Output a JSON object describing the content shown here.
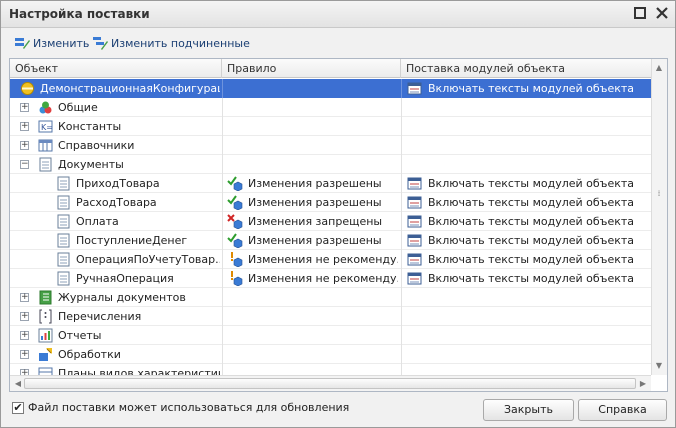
{
  "window": {
    "title": "Настройка поставки"
  },
  "toolbar": {
    "edit": "Изменить",
    "edit_children": "Изменить подчиненные"
  },
  "columns": {
    "object": "Объект",
    "rule": "Правило",
    "delivery": "Поставка модулей объекта"
  },
  "rows": [
    {
      "label": "ДемонстрационнаяКонфигурац...",
      "rule": "",
      "delivery": "Включать тексты модулей объекта"
    },
    {
      "label": "Общие",
      "rule": "",
      "delivery": ""
    },
    {
      "label": "Константы",
      "rule": "",
      "delivery": ""
    },
    {
      "label": "Справочники",
      "rule": "",
      "delivery": ""
    },
    {
      "label": "Документы",
      "rule": "",
      "delivery": ""
    },
    {
      "label": "ПриходТовара",
      "rule": "Изменения разрешены",
      "delivery": "Включать тексты модулей объекта"
    },
    {
      "label": "РасходТовара",
      "rule": "Изменения разрешены",
      "delivery": "Включать тексты модулей объекта"
    },
    {
      "label": "Оплата",
      "rule": "Изменения запрещены",
      "delivery": "Включать тексты модулей объекта"
    },
    {
      "label": "ПоступлениеДенег",
      "rule": "Изменения разрешены",
      "delivery": "Включать тексты модулей объекта"
    },
    {
      "label": "ОперацияПоУчетуТовар...",
      "rule": "Изменения не рекоменду...",
      "delivery": "Включать тексты модулей объекта"
    },
    {
      "label": "РучнаяОперация",
      "rule": "Изменения не рекоменду...",
      "delivery": "Включать тексты модулей объекта"
    },
    {
      "label": "Журналы документов",
      "rule": "",
      "delivery": ""
    },
    {
      "label": "Перечисления",
      "rule": "",
      "delivery": ""
    },
    {
      "label": "Отчеты",
      "rule": "",
      "delivery": ""
    },
    {
      "label": "Обработки",
      "rule": "",
      "delivery": ""
    },
    {
      "label": "Планы видов характеристик",
      "rule": "",
      "delivery": ""
    }
  ],
  "footer": {
    "checkbox_label": "Файл поставки может использоваться для обновления",
    "close": "Закрыть",
    "help": "Справка"
  },
  "colors": {
    "selection": "#3c6fd2",
    "allowed": "#2e9d2e",
    "denied": "#d02525",
    "warning": "#e08a00"
  }
}
